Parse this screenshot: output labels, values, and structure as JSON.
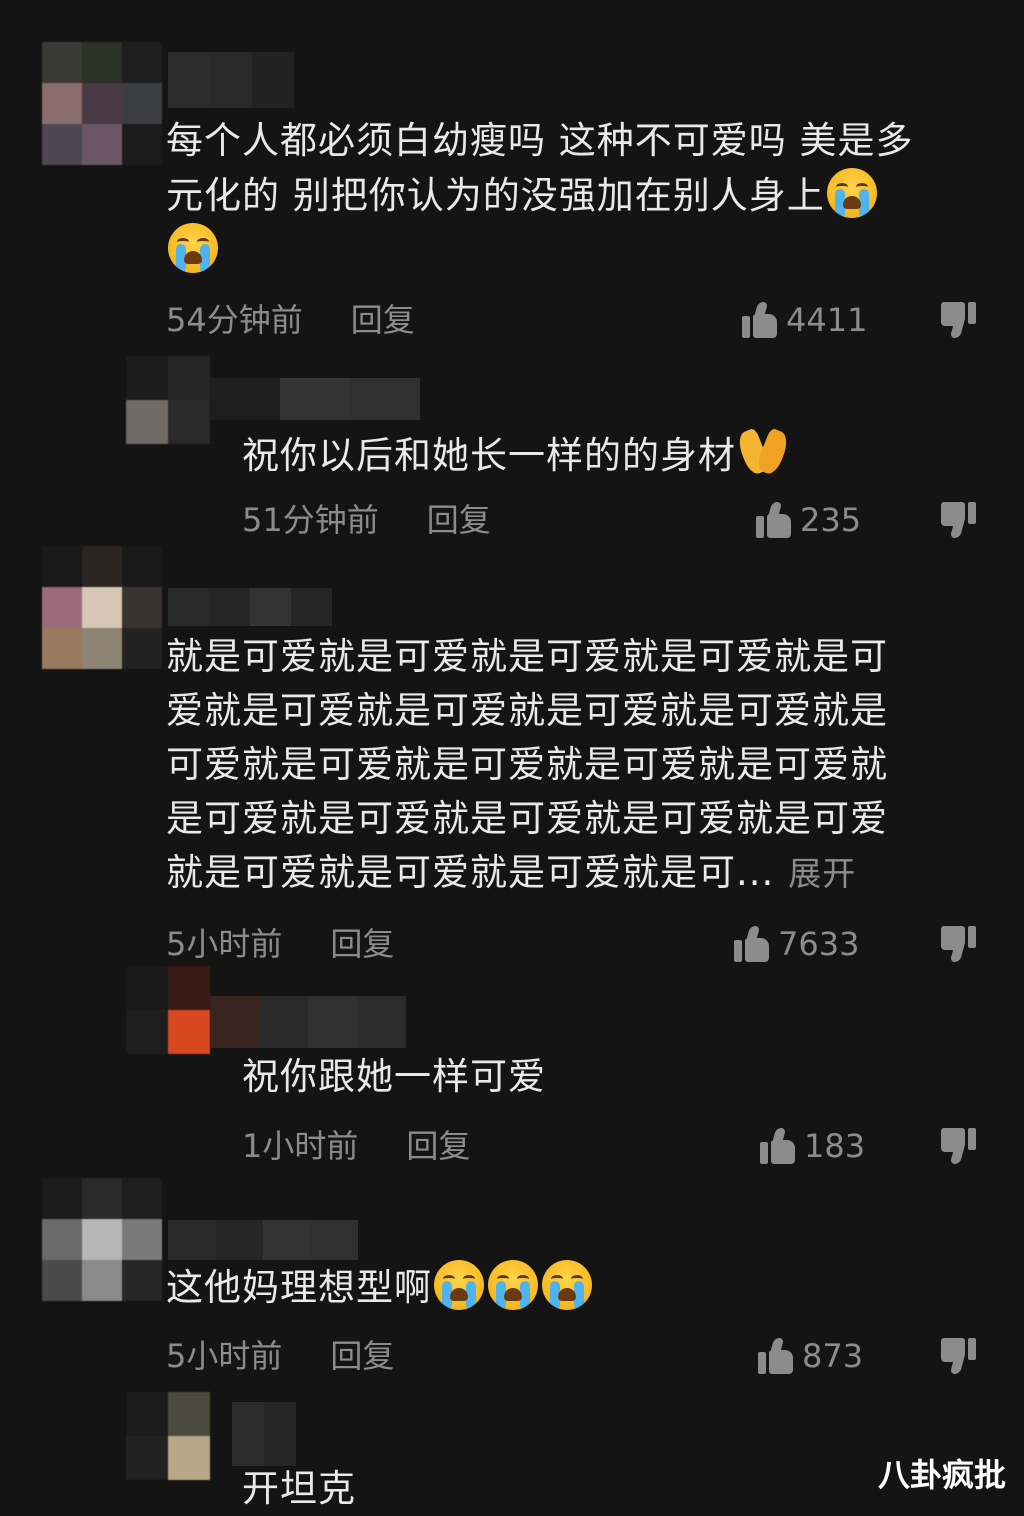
{
  "comments": [
    {
      "text_lines": [
        "每个人都必须白幼瘦吗 这种不可爱吗 美是多",
        "元化的 别把你认为的没强加在别人身上"
      ],
      "time": "54分钟前",
      "reply": "回复",
      "likes": "4411",
      "emoji_icons": [
        "crying-face-icon",
        "crying-face-icon"
      ]
    },
    {
      "text": "祝你以后和她长一样的的身材",
      "time": "51分钟前",
      "reply": "回复",
      "likes": "235",
      "emoji_icons": [
        "folded-hands-icon"
      ]
    },
    {
      "text_lines": [
        "就是可爱就是可爱就是可爱就是可爱就是可",
        "爱就是可爱就是可爱就是可爱就是可爱就是",
        "可爱就是可爱就是可爱就是可爱就是可爱就",
        "是可爱就是可爱就是可爱就是可爱就是可爱",
        "就是可爱就是可爱就是可爱就是可..."
      ],
      "expand": "展开",
      "time": "5小时前",
      "reply": "回复",
      "likes": "7633"
    },
    {
      "text": "祝你跟她一样可爱",
      "time": "1小时前",
      "reply": "回复",
      "likes": "183"
    },
    {
      "text": "这他妈理想型啊",
      "time": "5小时前",
      "reply": "回复",
      "likes": "873",
      "emoji_icons": [
        "crying-face-icon",
        "crying-face-icon",
        "crying-face-icon"
      ]
    },
    {
      "text": "开坦克"
    }
  ],
  "watermark": "八卦疯批"
}
